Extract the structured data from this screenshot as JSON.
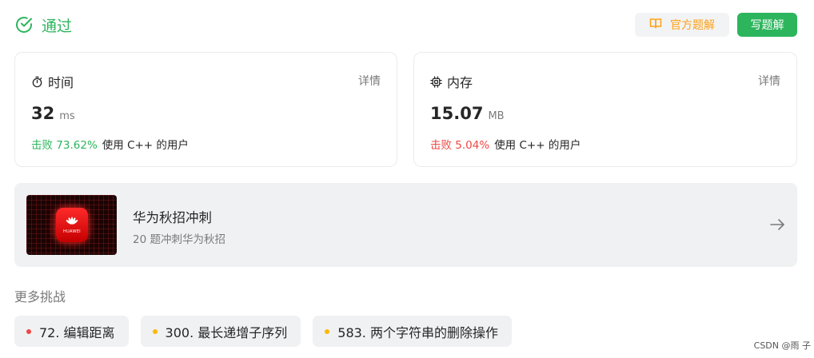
{
  "header": {
    "status": "通过",
    "official_solution_label": "官方题解",
    "write_solution_label": "写题解"
  },
  "colors": {
    "accepted_green": "#2db55d",
    "solution_orange": "#ffa116",
    "beat_red": "#ef4743",
    "easy_dot": "#ef4743",
    "medium_dot": "#ffb800"
  },
  "time_card": {
    "title": "时间",
    "detail": "详情",
    "value": "32",
    "unit": "ms",
    "beat_label": "击败 73.62%",
    "beat_suffix": "使用 C++ 的用户",
    "icon": "stopwatch-icon"
  },
  "memory_card": {
    "title": "内存",
    "detail": "详情",
    "value": "15.07",
    "unit": "MB",
    "beat_label": "击败 5.04%",
    "beat_suffix": "使用 C++ 的用户",
    "icon": "chip-icon"
  },
  "promo": {
    "title": "华为秋招冲刺",
    "subtitle": "20 题冲刺华为秋招",
    "image_logo_text": "HUAWEI"
  },
  "more": {
    "title": "更多挑战",
    "items": [
      {
        "label": "72. 编辑距离",
        "dot": "red"
      },
      {
        "label": "300. 最长递增子序列",
        "dot": "yellow"
      },
      {
        "label": "583. 两个字符串的删除操作",
        "dot": "yellow"
      }
    ]
  },
  "watermark": "CSDN @雨 子"
}
